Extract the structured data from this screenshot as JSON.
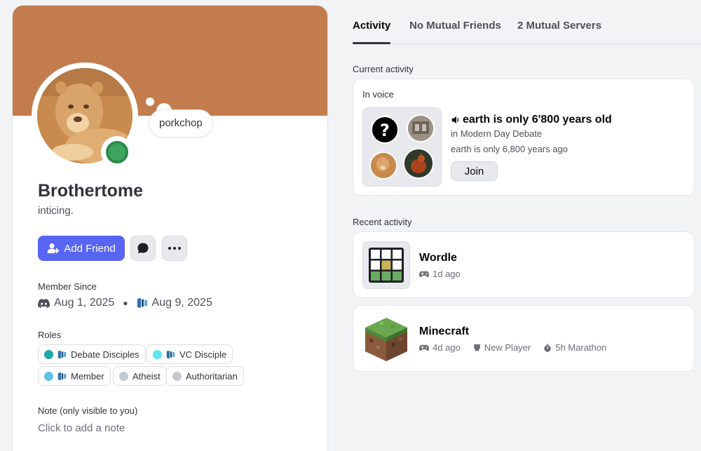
{
  "profile": {
    "display_name": "Brothertome",
    "tagline": "inticing.",
    "custom_status": "porkchop",
    "banner_color": "#c27c4e",
    "status_color": "#3ba55d"
  },
  "actions": {
    "add_friend_label": "Add Friend"
  },
  "member_since": {
    "label": "Member Since",
    "discord_date": "Aug 1, 2025",
    "server_date": "Aug 9, 2025"
  },
  "roles": {
    "label": "Roles",
    "items": [
      {
        "name": "Debate Disciples",
        "color": "#1fa8a8"
      },
      {
        "name": "VC Disciple",
        "color": "#5ee6ef"
      },
      {
        "name": "Member",
        "color": "#5bc2e8"
      },
      {
        "name": "Atheist",
        "color": "#c4c9ce"
      },
      {
        "name": "Authoritarian",
        "color": "#c4c9ce"
      }
    ]
  },
  "note": {
    "label": "Note (only visible to you)",
    "placeholder": "Click to add a note"
  },
  "tabs": [
    {
      "label": "Activity",
      "active": true
    },
    {
      "label": "No Mutual Friends",
      "active": false
    },
    {
      "label": "2 Mutual Servers",
      "active": false
    }
  ],
  "current_activity": {
    "heading": "Current activity",
    "voice_label": "In voice",
    "channel_name": "earth is only 6'800 years old",
    "server_line": "in Modern Day Debate",
    "topic": "earth is only 6,800 years ago",
    "join_label": "Join"
  },
  "recent_activity": {
    "heading": "Recent activity",
    "games": [
      {
        "name": "Wordle",
        "meta": [
          {
            "icon": "gamepad-icon",
            "text": "1d ago"
          }
        ]
      },
      {
        "name": "Minecraft",
        "meta": [
          {
            "icon": "gamepad-icon",
            "text": "4d ago"
          },
          {
            "icon": "badge-icon",
            "text": "New Player"
          },
          {
            "icon": "stopwatch-icon",
            "text": "5h Marathon"
          }
        ]
      }
    ]
  }
}
